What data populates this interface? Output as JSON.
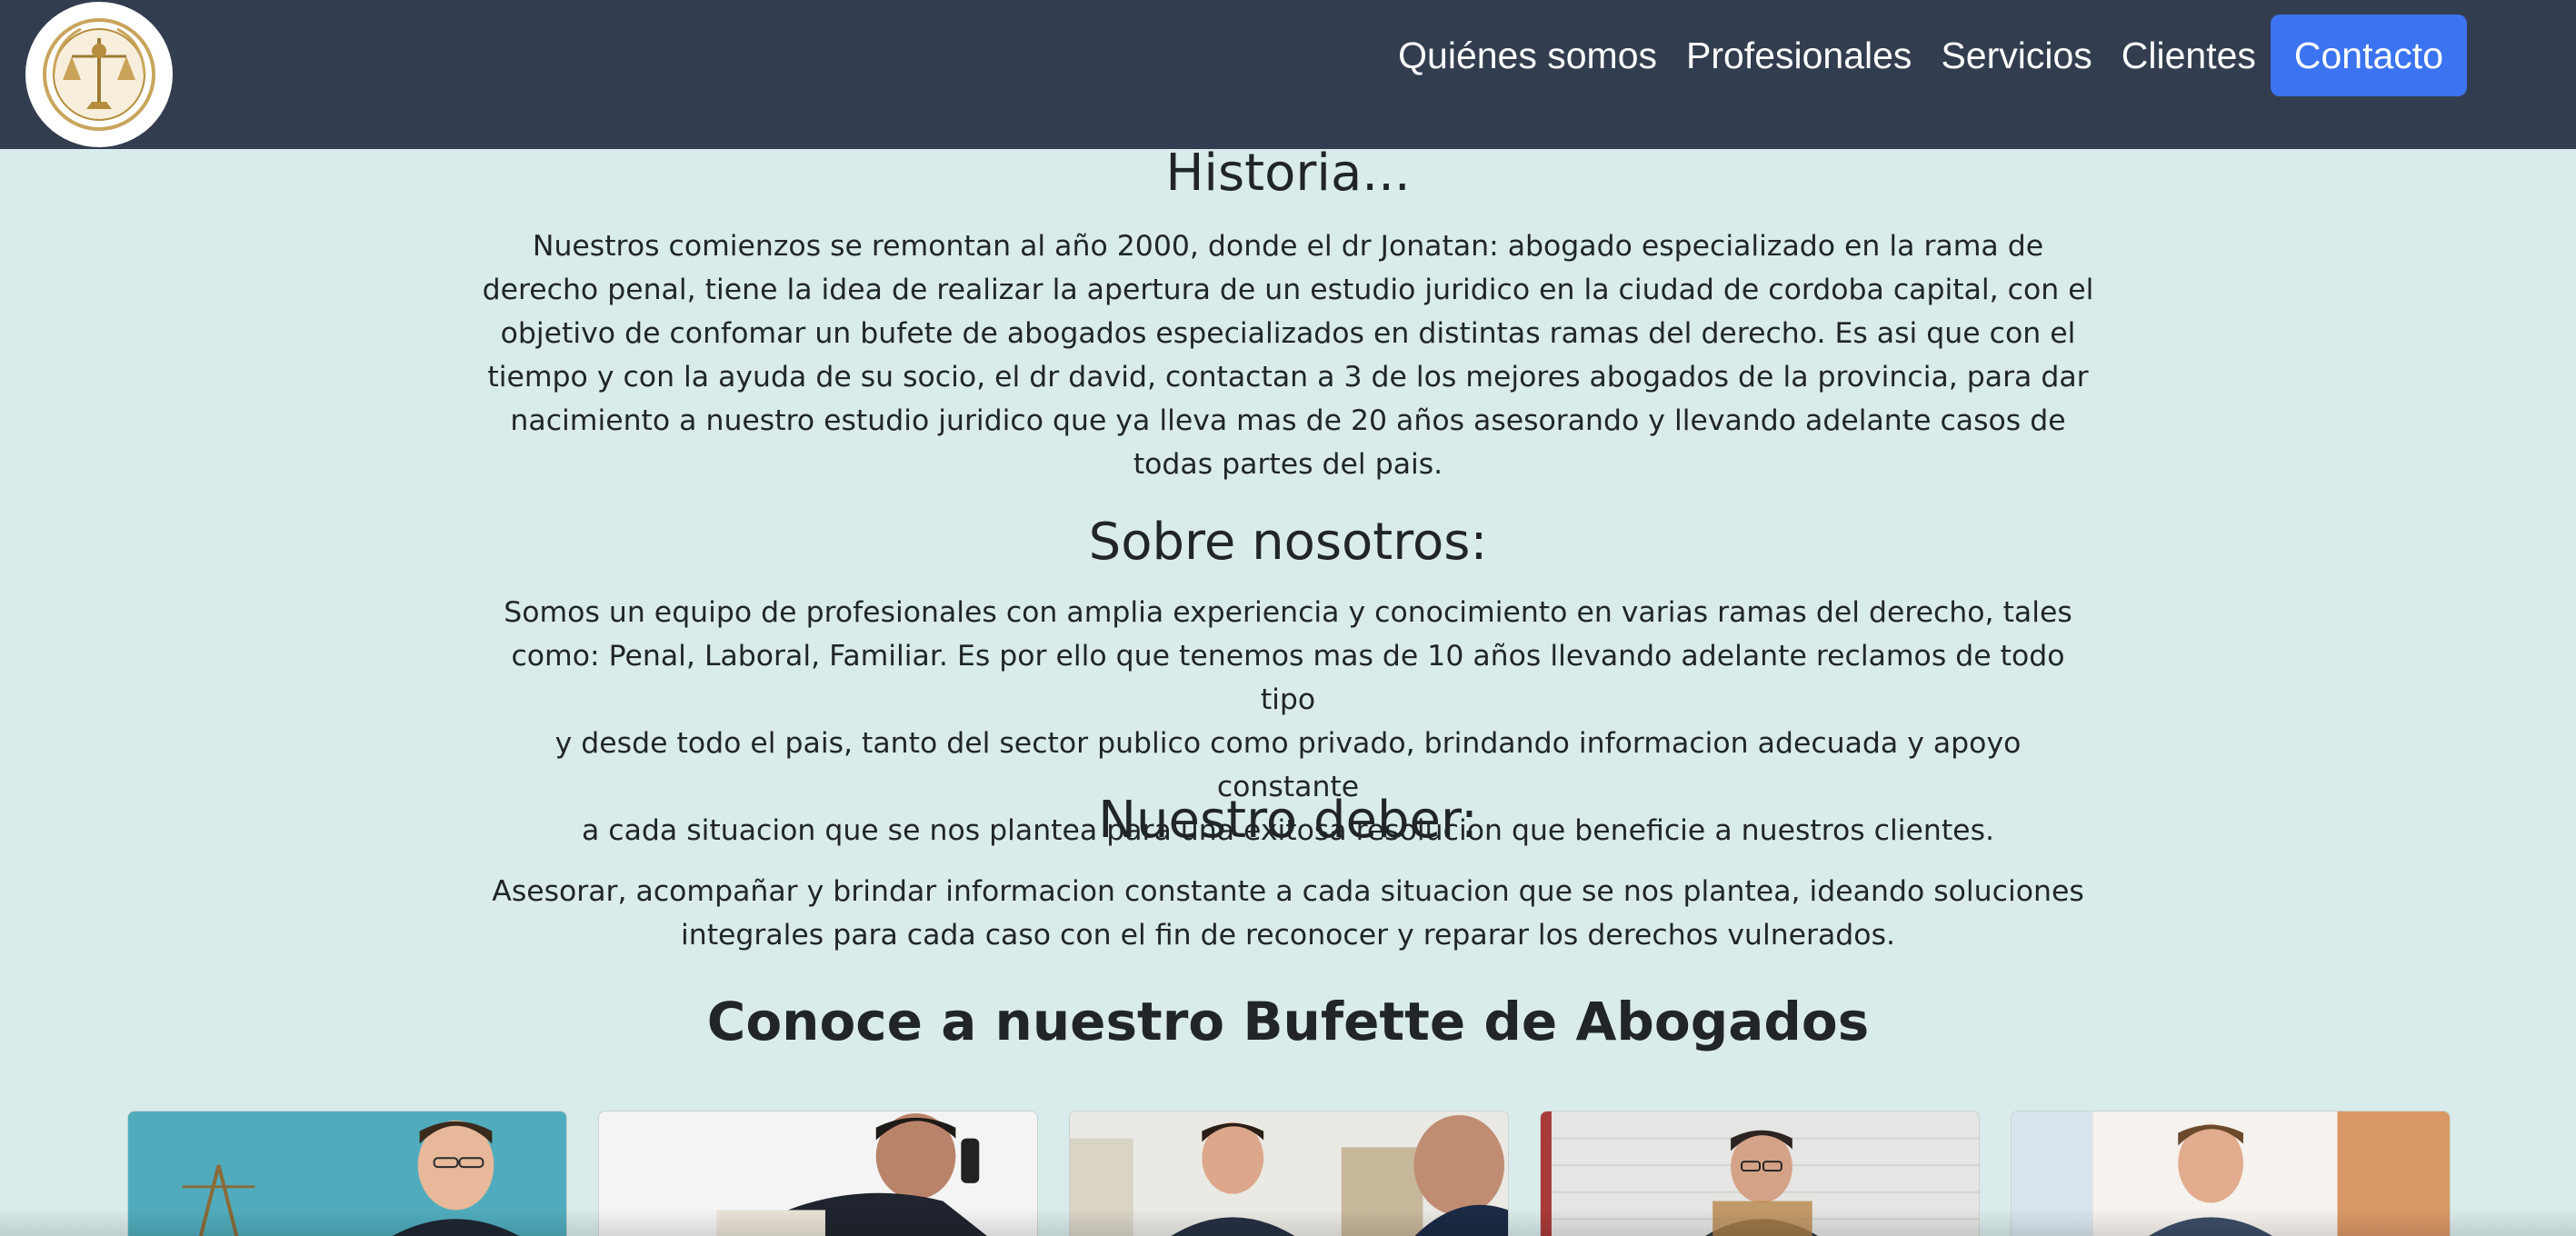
{
  "nav": {
    "logo_alt": "bufete-logo",
    "links": [
      "Quiénes somos",
      "Profesionales",
      "Servicios",
      "Clientes"
    ],
    "contact": "Contacto",
    "colors": {
      "bar": "#323e4f",
      "contact": "#3b73f0"
    }
  },
  "historia": {
    "title": "Historia...",
    "lines": [
      "Nuestros comienzos se remontan al año 2000, donde el dr Jonatan: abogado especializado en la rama de",
      "derecho penal, tiene la idea de realizar la apertura de un estudio juridico en la ciudad de cordoba capital, con el",
      "objetivo de confomar un bufete de abogados especializados en distintas ramas del derecho. Es asi que con el",
      "tiempo y con la ayuda de su socio, el dr david, contactan a 3 de los mejores abogados de la provincia, para dar",
      "nacimiento a nuestro estudio juridico que ya lleva mas de 20 años asesorando y llevando adelante casos de",
      "todas partes del pais."
    ]
  },
  "sobre": {
    "title": "Sobre nosotros:",
    "lines": [
      "Somos un equipo de profesionales con amplia experiencia y conocimiento en varias ramas del derecho, tales",
      "como: Penal, Laboral, Familiar. Es por ello que tenemos mas de 10 años llevando adelante reclamos de todo tipo",
      "y desde todo el pais, tanto del sector publico como privado, brindando informacion adecuada y apoyo constante",
      "a cada situacion que se nos plantea para una exitosa resolucion que beneficie a nuestros clientes."
    ]
  },
  "deber": {
    "title": "Nuestro deber:",
    "lines": [
      "Asesorar, acompañar y brindar informacion constante a cada situacion que se nos plantea, ideando soluciones",
      "integrales para cada caso con el fin de reconocer y reparar los derechos vulnerados."
    ]
  },
  "team": {
    "title": "Conoce a nuestro Bufette de Abogados",
    "cards": [
      "lawyer-photo-1",
      "lawyer-photo-2",
      "lawyer-photo-3",
      "lawyer-photo-4",
      "lawyer-photo-5"
    ]
  },
  "colors": {
    "background": "#d9ebea",
    "text": "#212529"
  }
}
